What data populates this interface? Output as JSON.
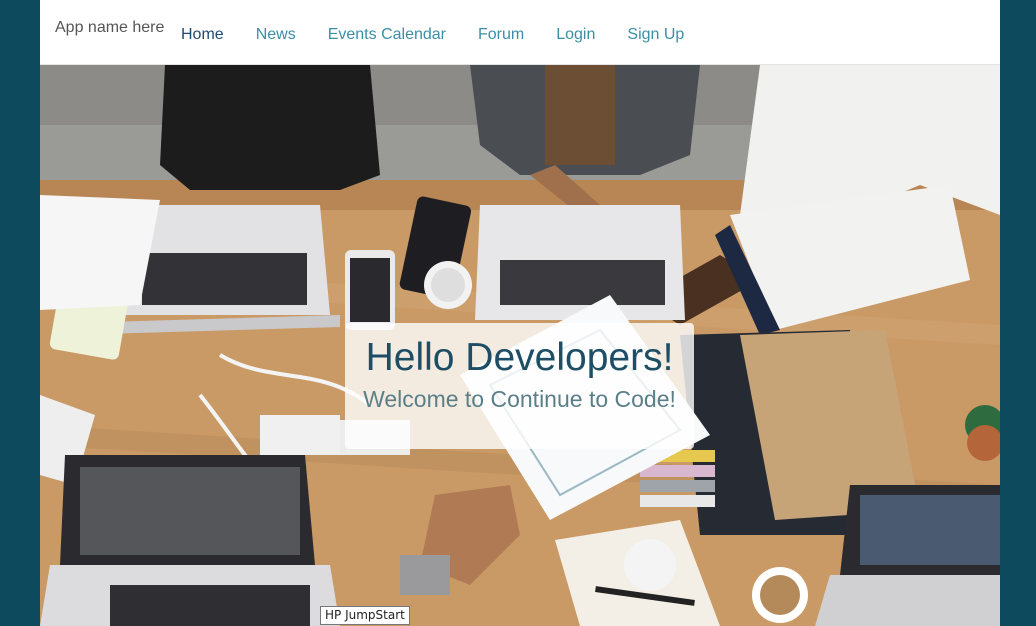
{
  "navbar": {
    "brand": "App name here",
    "items": [
      {
        "label": "Home",
        "active": true
      },
      {
        "label": "News",
        "active": false
      },
      {
        "label": "Events Calendar",
        "active": false
      },
      {
        "label": "Forum",
        "active": false
      },
      {
        "label": "Login",
        "active": false
      },
      {
        "label": "Sign Up",
        "active": false
      }
    ]
  },
  "hero": {
    "title": "Hello Developers!",
    "subtitle": "Welcome to Continue to Code!"
  },
  "tooltip": {
    "text": "HP JumpStart"
  },
  "colors": {
    "background": "#0e4a5e",
    "nav_link": "#3a8fa6",
    "nav_active": "#1e4b75",
    "title": "#1d4e65",
    "subtitle": "#5b7f88"
  }
}
